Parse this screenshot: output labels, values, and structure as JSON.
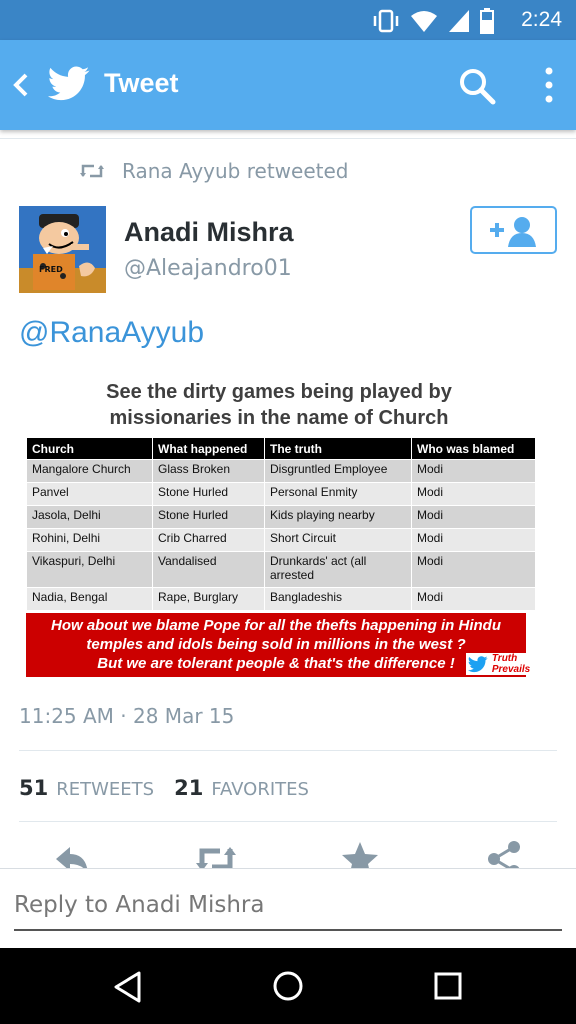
{
  "status_bar": {
    "time": "2:24"
  },
  "app_bar": {
    "title": "Tweet"
  },
  "tweet": {
    "retweeted_by": "Rana Ayyub retweeted",
    "author_name": "Anadi Mishra",
    "author_handle": "@Aleajandro01",
    "avatar_label": "FRED",
    "mention": "@RanaAyyub",
    "image": {
      "title_line1": "See the dirty games being played by",
      "title_line2": "missionaries in the name of Church",
      "headers": [
        "Church",
        "What happened",
        "The truth",
        "Who was blamed"
      ],
      "rows": [
        [
          "Mangalore Church",
          "Glass Broken",
          "Disgruntled Employee",
          "Modi"
        ],
        [
          "Panvel",
          "Stone Hurled",
          "Personal Enmity",
          "Modi"
        ],
        [
          "Jasola, Delhi",
          "Stone Hurled",
          "Kids playing nearby",
          "Modi"
        ],
        [
          "Rohini, Delhi",
          "Crib Charred",
          "Short Circuit",
          "Modi"
        ],
        [
          "Vikaspuri, Delhi",
          "Vandalised",
          "Drunkards' act (all arrested",
          "Modi"
        ],
        [
          "Nadia, Bengal",
          "Rape, Burglary",
          "Bangladeshis",
          "Modi"
        ]
      ],
      "banner_line1": "How about we blame Pope for all the thefts happening in Hindu",
      "banner_line2": "temples and idols being sold in millions in the west ?",
      "banner_line3": "But we are tolerant people & that's the difference !",
      "watermark": "Truth Prevails"
    },
    "timestamp": "11:25 AM · 28 Mar 15",
    "retweets_count": "51",
    "retweets_label": "RETWEETS",
    "favorites_count": "21",
    "favorites_label": "FAVORITES"
  },
  "reply": {
    "placeholder": "Reply to Anadi Mishra"
  },
  "colors": {
    "status_bar": "#3a85c6",
    "app_bar": "#55acee",
    "link": "#3b94d9",
    "muted": "#8899a6",
    "banner": "#cc0000"
  },
  "icons": [
    "vibrate-icon",
    "wifi-icon",
    "signal-icon",
    "battery-icon",
    "back-icon",
    "twitter-bird-icon",
    "search-icon",
    "more-icon",
    "retweet-icon",
    "follow-icon",
    "reply-icon",
    "favorite-icon",
    "share-icon",
    "nav-back-icon",
    "nav-home-icon",
    "nav-recents-icon"
  ]
}
